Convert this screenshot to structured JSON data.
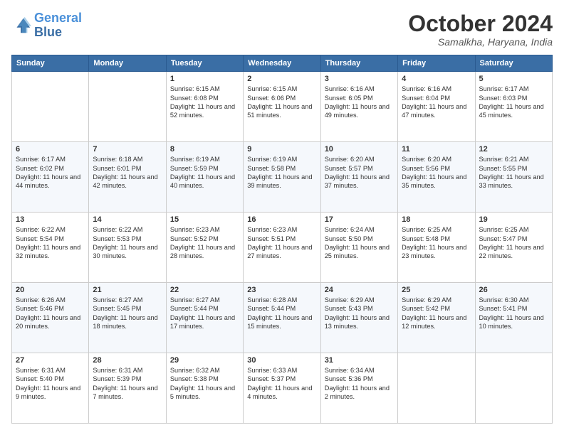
{
  "logo": {
    "line1": "General",
    "line2": "Blue"
  },
  "header": {
    "month": "October 2024",
    "location": "Samalkha, Haryana, India"
  },
  "weekdays": [
    "Sunday",
    "Monday",
    "Tuesday",
    "Wednesday",
    "Thursday",
    "Friday",
    "Saturday"
  ],
  "weeks": [
    [
      null,
      null,
      {
        "day": 1,
        "sunrise": "6:15 AM",
        "sunset": "6:08 PM",
        "daylight": "11 hours and 52 minutes."
      },
      {
        "day": 2,
        "sunrise": "6:15 AM",
        "sunset": "6:06 PM",
        "daylight": "11 hours and 51 minutes."
      },
      {
        "day": 3,
        "sunrise": "6:16 AM",
        "sunset": "6:05 PM",
        "daylight": "11 hours and 49 minutes."
      },
      {
        "day": 4,
        "sunrise": "6:16 AM",
        "sunset": "6:04 PM",
        "daylight": "11 hours and 47 minutes."
      },
      {
        "day": 5,
        "sunrise": "6:17 AM",
        "sunset": "6:03 PM",
        "daylight": "11 hours and 45 minutes."
      }
    ],
    [
      {
        "day": 6,
        "sunrise": "6:17 AM",
        "sunset": "6:02 PM",
        "daylight": "11 hours and 44 minutes."
      },
      {
        "day": 7,
        "sunrise": "6:18 AM",
        "sunset": "6:01 PM",
        "daylight": "11 hours and 42 minutes."
      },
      {
        "day": 8,
        "sunrise": "6:19 AM",
        "sunset": "5:59 PM",
        "daylight": "11 hours and 40 minutes."
      },
      {
        "day": 9,
        "sunrise": "6:19 AM",
        "sunset": "5:58 PM",
        "daylight": "11 hours and 39 minutes."
      },
      {
        "day": 10,
        "sunrise": "6:20 AM",
        "sunset": "5:57 PM",
        "daylight": "11 hours and 37 minutes."
      },
      {
        "day": 11,
        "sunrise": "6:20 AM",
        "sunset": "5:56 PM",
        "daylight": "11 hours and 35 minutes."
      },
      {
        "day": 12,
        "sunrise": "6:21 AM",
        "sunset": "5:55 PM",
        "daylight": "11 hours and 33 minutes."
      }
    ],
    [
      {
        "day": 13,
        "sunrise": "6:22 AM",
        "sunset": "5:54 PM",
        "daylight": "11 hours and 32 minutes."
      },
      {
        "day": 14,
        "sunrise": "6:22 AM",
        "sunset": "5:53 PM",
        "daylight": "11 hours and 30 minutes."
      },
      {
        "day": 15,
        "sunrise": "6:23 AM",
        "sunset": "5:52 PM",
        "daylight": "11 hours and 28 minutes."
      },
      {
        "day": 16,
        "sunrise": "6:23 AM",
        "sunset": "5:51 PM",
        "daylight": "11 hours and 27 minutes."
      },
      {
        "day": 17,
        "sunrise": "6:24 AM",
        "sunset": "5:50 PM",
        "daylight": "11 hours and 25 minutes."
      },
      {
        "day": 18,
        "sunrise": "6:25 AM",
        "sunset": "5:48 PM",
        "daylight": "11 hours and 23 minutes."
      },
      {
        "day": 19,
        "sunrise": "6:25 AM",
        "sunset": "5:47 PM",
        "daylight": "11 hours and 22 minutes."
      }
    ],
    [
      {
        "day": 20,
        "sunrise": "6:26 AM",
        "sunset": "5:46 PM",
        "daylight": "11 hours and 20 minutes."
      },
      {
        "day": 21,
        "sunrise": "6:27 AM",
        "sunset": "5:45 PM",
        "daylight": "11 hours and 18 minutes."
      },
      {
        "day": 22,
        "sunrise": "6:27 AM",
        "sunset": "5:44 PM",
        "daylight": "11 hours and 17 minutes."
      },
      {
        "day": 23,
        "sunrise": "6:28 AM",
        "sunset": "5:44 PM",
        "daylight": "11 hours and 15 minutes."
      },
      {
        "day": 24,
        "sunrise": "6:29 AM",
        "sunset": "5:43 PM",
        "daylight": "11 hours and 13 minutes."
      },
      {
        "day": 25,
        "sunrise": "6:29 AM",
        "sunset": "5:42 PM",
        "daylight": "11 hours and 12 minutes."
      },
      {
        "day": 26,
        "sunrise": "6:30 AM",
        "sunset": "5:41 PM",
        "daylight": "11 hours and 10 minutes."
      }
    ],
    [
      {
        "day": 27,
        "sunrise": "6:31 AM",
        "sunset": "5:40 PM",
        "daylight": "11 hours and 9 minutes."
      },
      {
        "day": 28,
        "sunrise": "6:31 AM",
        "sunset": "5:39 PM",
        "daylight": "11 hours and 7 minutes."
      },
      {
        "day": 29,
        "sunrise": "6:32 AM",
        "sunset": "5:38 PM",
        "daylight": "11 hours and 5 minutes."
      },
      {
        "day": 30,
        "sunrise": "6:33 AM",
        "sunset": "5:37 PM",
        "daylight": "11 hours and 4 minutes."
      },
      {
        "day": 31,
        "sunrise": "6:34 AM",
        "sunset": "5:36 PM",
        "daylight": "11 hours and 2 minutes."
      },
      null,
      null
    ]
  ]
}
